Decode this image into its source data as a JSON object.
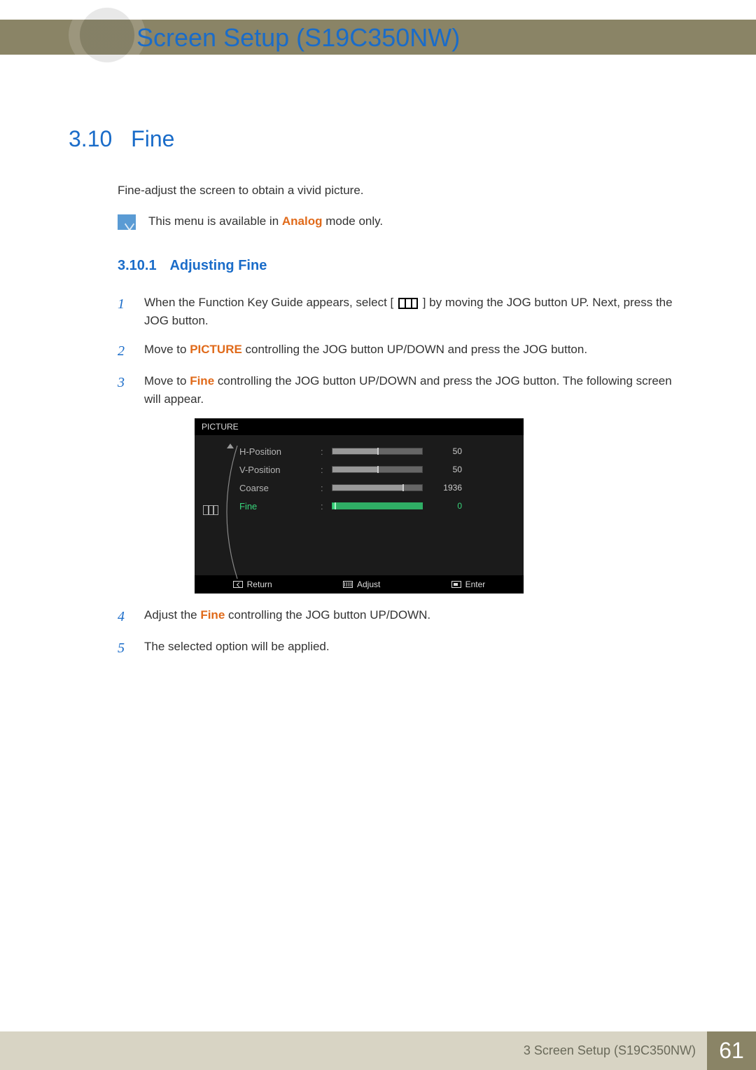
{
  "page_title": "Screen Setup (S19C350NW)",
  "section": {
    "number": "3.10",
    "title": "Fine"
  },
  "intro": "Fine-adjust the screen to obtain a vivid picture.",
  "note": {
    "prefix": "This menu is available in ",
    "highlight": "Analog",
    "suffix": " mode only."
  },
  "subsection": {
    "number": "3.10.1",
    "title": "Adjusting Fine"
  },
  "steps": {
    "s1": {
      "num": "1",
      "a": "When the Function Key Guide appears, select ",
      "lb": "[ ",
      "rb": " ]",
      "b": " by moving the JOG button UP. Next, press the JOG button."
    },
    "s2": {
      "num": "2",
      "a": "Move to ",
      "hl": "PICTURE",
      "b": " controlling the JOG button UP/DOWN and press the JOG button."
    },
    "s3": {
      "num": "3",
      "a": "Move to ",
      "hl": "Fine",
      "b": " controlling the JOG button UP/DOWN and press the JOG button. The following screen will appear."
    },
    "s4": {
      "num": "4",
      "a": "Adjust the ",
      "hl": "Fine",
      "b": " controlling the JOG button UP/DOWN."
    },
    "s5": {
      "num": "5",
      "a": "The selected option will be applied."
    }
  },
  "osd": {
    "title": "PICTURE",
    "rows": [
      {
        "label": "H-Position",
        "value": "50",
        "pct": 50,
        "active": false
      },
      {
        "label": "V-Position",
        "value": "50",
        "pct": 50,
        "active": false
      },
      {
        "label": "Coarse",
        "value": "1936",
        "pct": 78,
        "active": false
      },
      {
        "label": "Fine",
        "value": "0",
        "pct": 2,
        "active": true
      }
    ],
    "footer": {
      "return": "Return",
      "adjust": "Adjust",
      "enter": "Enter"
    }
  },
  "footer": {
    "text": "3 Screen Setup (S19C350NW)",
    "page": "61"
  }
}
